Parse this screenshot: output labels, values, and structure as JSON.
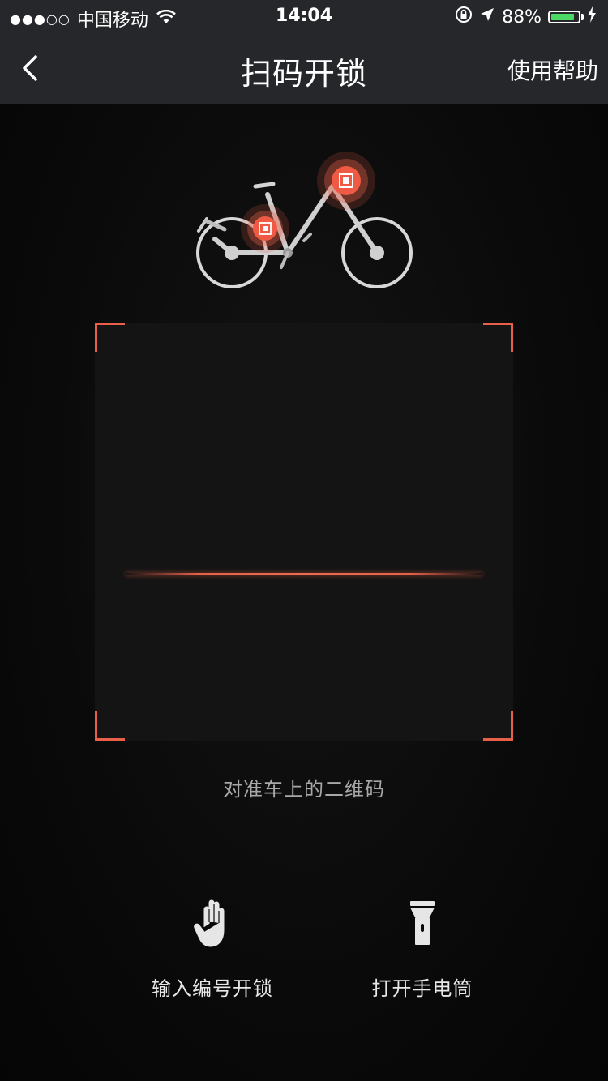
{
  "status_bar": {
    "signal": "●●●○○",
    "carrier": "中国移动",
    "time": "14:04",
    "battery_percent": "88%",
    "battery_level": 0.88
  },
  "nav": {
    "back_icon": "chevron-left-icon",
    "title": "扫码开锁",
    "help_label": "使用帮助"
  },
  "scanner": {
    "hint": "对准车上的二维码",
    "accent_color": "#e8604a"
  },
  "actions": [
    {
      "label": "输入编号开锁",
      "icon": "hand-icon"
    },
    {
      "label": "打开手电筒",
      "icon": "flashlight-icon"
    }
  ]
}
